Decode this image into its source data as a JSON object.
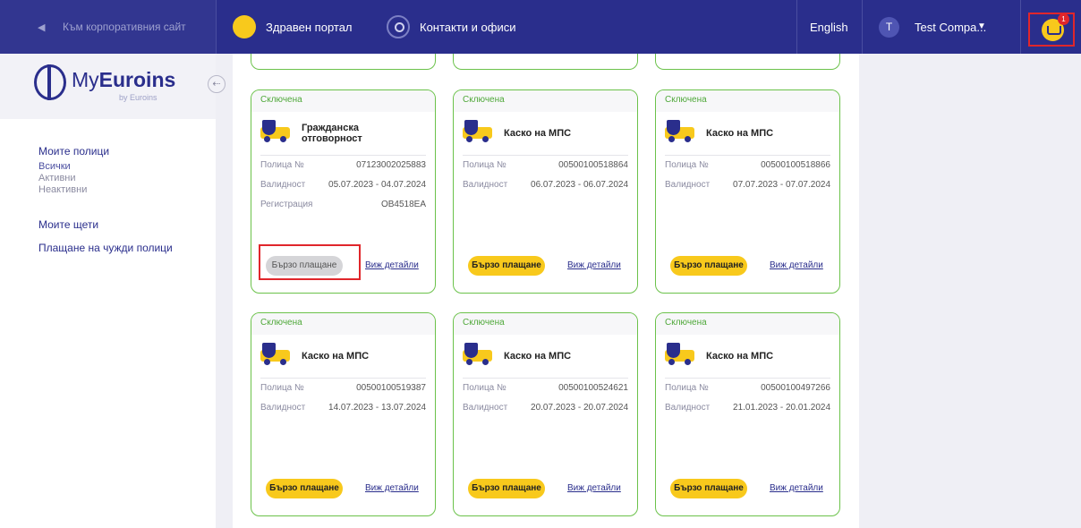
{
  "topbar": {
    "back_icon": "chevron-left-icon",
    "back_label": "Към корпоративния сайт",
    "health_label": "Здравен портал",
    "contacts_label": "Контакти и офиси",
    "language": "English",
    "avatar_initial": "T",
    "user_name": "Test Compa...",
    "cart_count": "1"
  },
  "sidebar": {
    "logo_prefix": "My",
    "logo_bold": "Euroins",
    "logo_sub": "by Euroins",
    "my_policies": "Моите полици",
    "filters": [
      "Всички",
      "Активни",
      "Неактивни"
    ],
    "my_claims": "Моите щети",
    "pay_others": "Плащане на чужди полици"
  },
  "labels": {
    "policy_no": "Полица №",
    "validity": "Валидност",
    "registration": "Регистрация",
    "quick_pay": "Бързо плащане",
    "see_details": "Виж детайли"
  },
  "cards": [
    {
      "status": "Сключена",
      "product": "Гражданска отговорност",
      "policy": "07123002025883",
      "validity": "05.07.2023 - 04.07.2024",
      "registration": "ОВ4518ЕА"
    },
    {
      "status": "Сключена",
      "product": "Каско на МПС",
      "policy": "00500100518864",
      "validity": "06.07.2023 - 06.07.2024"
    },
    {
      "status": "Сключена",
      "product": "Каско на МПС",
      "policy": "00500100518866",
      "validity": "07.07.2023 - 07.07.2024"
    },
    {
      "status": "Сключена",
      "product": "Каско на МПС",
      "policy": "00500100519387",
      "validity": "14.07.2023 - 13.07.2024"
    },
    {
      "status": "Сключена",
      "product": "Каско на МПС",
      "policy": "00500100524621",
      "validity": "20.07.2023 - 20.07.2024"
    },
    {
      "status": "Сключена",
      "product": "Каско на МПС",
      "policy": "00500100497266",
      "validity": "21.01.2023 - 20.01.2024"
    }
  ],
  "colors": {
    "brand": "#2a2e8c",
    "accent": "#f8c91c",
    "status_green": "#6bc24a",
    "highlight_red": "#e0262b"
  }
}
